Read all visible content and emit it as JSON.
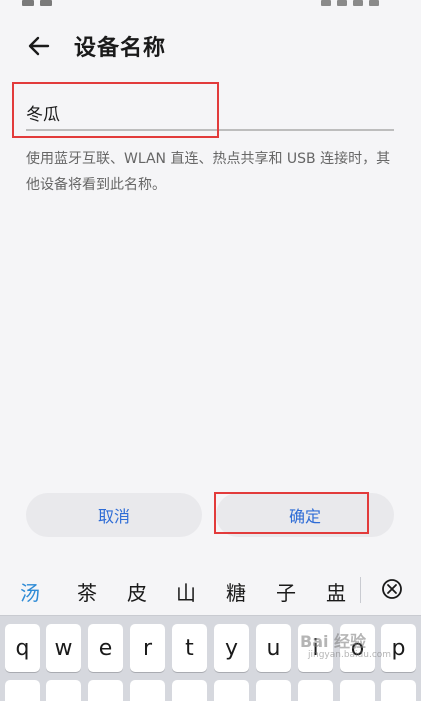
{
  "header": {
    "title": "设备名称"
  },
  "field": {
    "value": "冬瓜"
  },
  "description": "使用蓝牙互联、WLAN 直连、热点共享和 USB 连接时，其他设备将看到此名称。",
  "buttons": {
    "cancel": "取消",
    "ok": "确定"
  },
  "keyboard": {
    "candidates": [
      "汤",
      "茶",
      "皮",
      "山",
      "糖",
      "子",
      "盅"
    ],
    "row1": [
      "q",
      "w",
      "e",
      "r",
      "t",
      "y",
      "u",
      "i",
      "o",
      "p"
    ]
  },
  "watermark": {
    "text": "Bai 经验",
    "sub": "jingyan.baidu.com"
  },
  "colors": {
    "accent": "#2e6cd6",
    "highlight": "#e23b3b",
    "candidate_selected": "#2e8bd6"
  }
}
